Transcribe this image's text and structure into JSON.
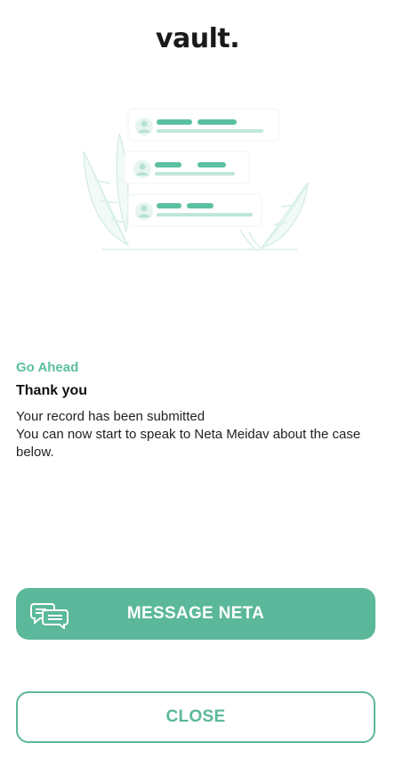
{
  "app": {
    "logo_text": "vault."
  },
  "illustration": {
    "name": "chat-messages-illustration",
    "accent_color": "#5bbfa2"
  },
  "message": {
    "eyebrow": "Go Ahead",
    "heading": "Thank you",
    "line1": "Your record has been submitted",
    "line2": "You can now start to speak to Neta Meidav about the case below."
  },
  "actions": {
    "primary_label": "MESSAGE NETA",
    "primary_icon": "chat-bubbles-icon",
    "secondary_label": "CLOSE"
  },
  "colors": {
    "accent": "#5bb89b",
    "background": "#ffffff",
    "text": "#111111"
  }
}
